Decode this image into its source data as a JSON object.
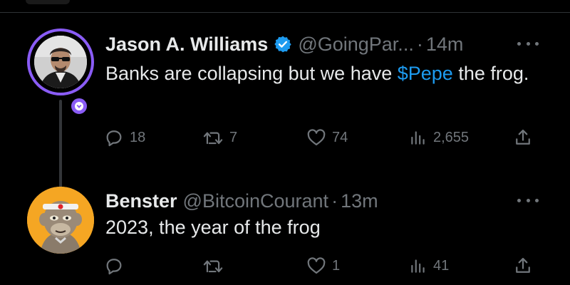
{
  "colors": {
    "background": "#000000",
    "text": "#e7e9ea",
    "muted": "#71767b",
    "accent": "#1d9bf0",
    "ring": "#8a5cf6"
  },
  "tweets": [
    {
      "author_name": "Jason A. Williams",
      "verified": true,
      "handle": "@GoingPar...",
      "separator": "·",
      "time": "14m",
      "text_before": "Banks are collapsing but we have ",
      "cashtag": "$Pepe",
      "text_after": " the frog.",
      "avatar_icon": "person-photo-avatar",
      "badge_icon": "subscriber-badge-icon",
      "actions": {
        "reply_count": "18",
        "retweet_count": "7",
        "like_count": "74",
        "views_count": "2,655"
      }
    },
    {
      "author_name": "Benster",
      "verified": false,
      "handle": "@BitcoinCourant",
      "separator": "·",
      "time": "13m",
      "text": "2023, the year of the frog",
      "avatar_icon": "ape-nft-avatar",
      "actions": {
        "reply_count": "",
        "retweet_count": "",
        "like_count": "1",
        "views_count": "41"
      }
    }
  ]
}
